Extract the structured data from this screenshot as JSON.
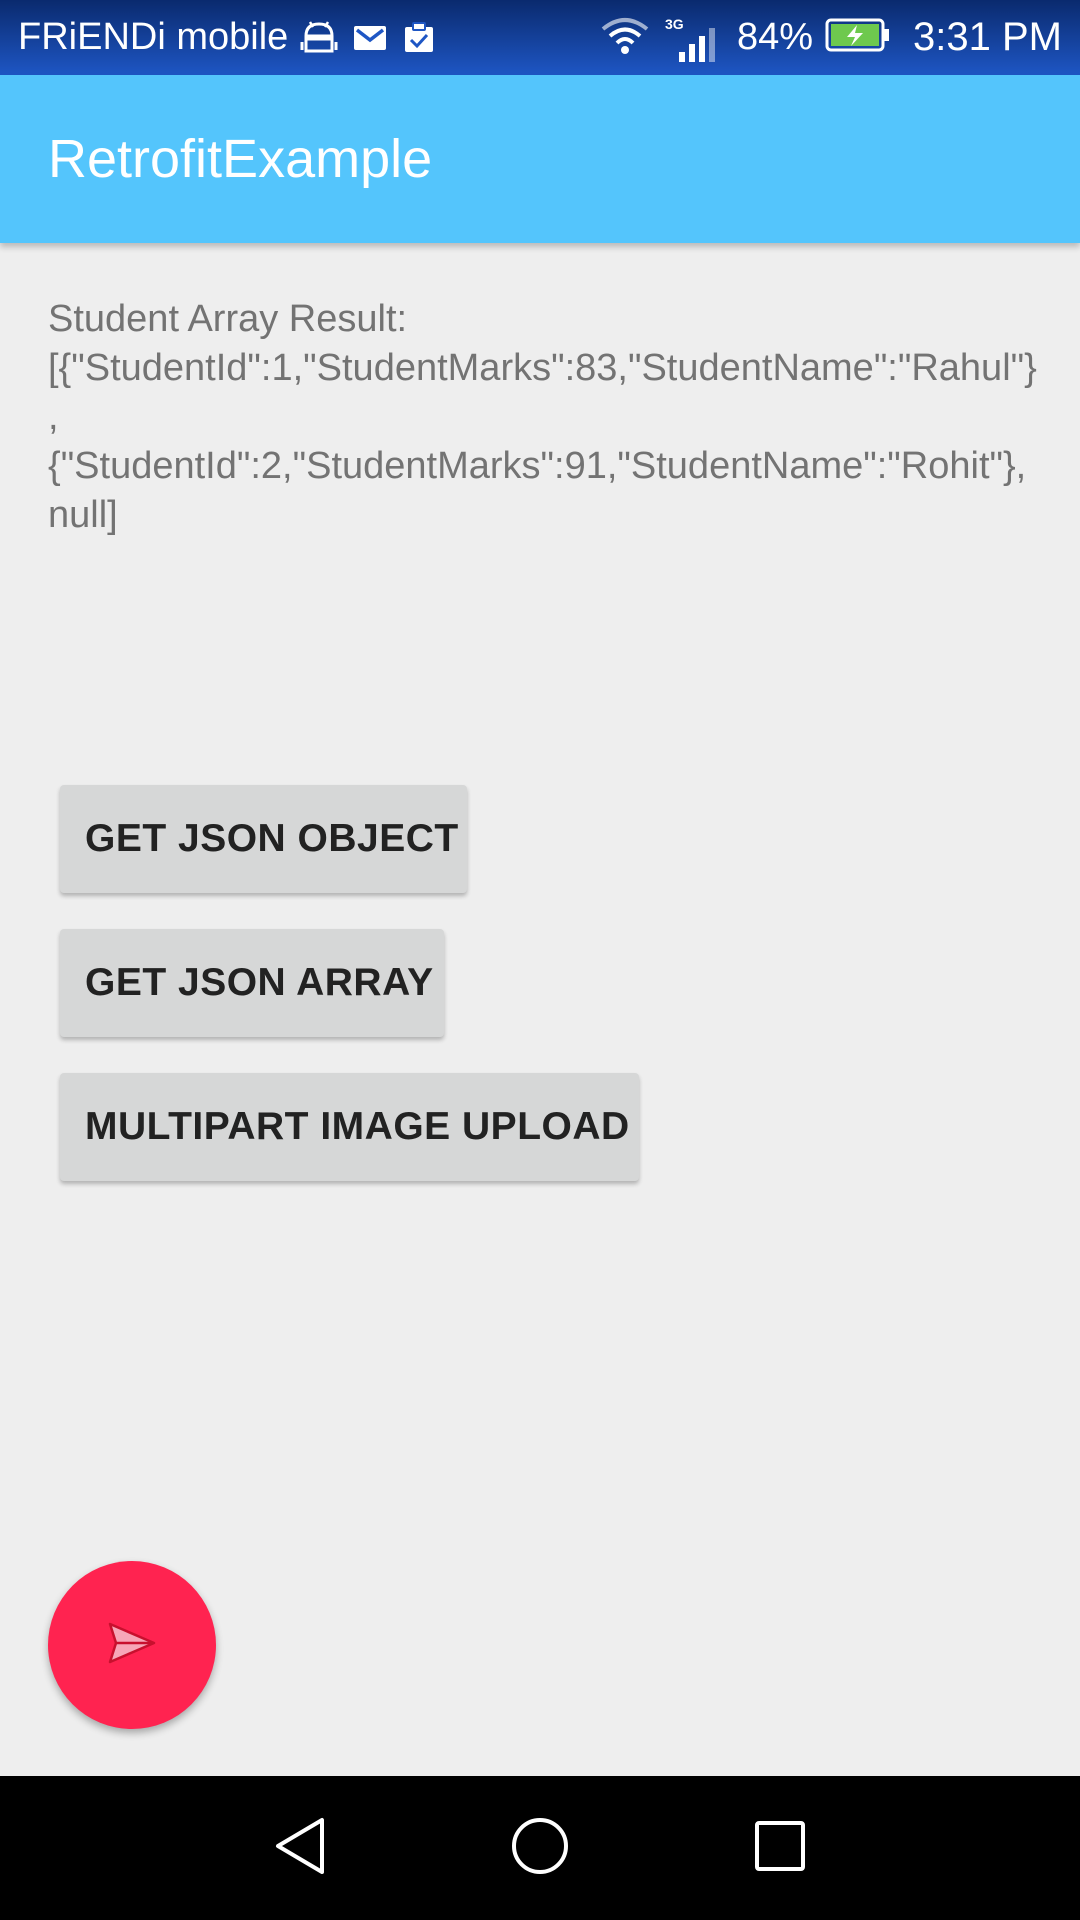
{
  "status_bar": {
    "carrier": "FRiENDi mobile",
    "network_type": "3G",
    "battery_percent": "84%",
    "time": "3:31 PM",
    "icons": [
      "android-notification-icon",
      "gmail-icon",
      "clipboard-check-icon",
      "wifi-icon",
      "signal-icon",
      "battery-charging-icon"
    ]
  },
  "app_bar": {
    "title": "RetrofitExample"
  },
  "content": {
    "result_text": "Student Array Result: [{\"StudentId\":1,\"StudentMarks\":83,\"StudentName\":\"Rahul\"},{\"StudentId\":2,\"StudentMarks\":91,\"StudentName\":\"Rohit\"},null]"
  },
  "buttons": {
    "get_json_object": "GET JSON OBJECT",
    "get_json_array": "GET JSON ARRAY",
    "multipart_upload": "MULTIPART IMAGE UPLOAD"
  },
  "fab": {
    "icon": "send-icon",
    "color": "#ff2350"
  },
  "nav_bar": {
    "icons": [
      "back-icon",
      "home-icon",
      "recents-icon"
    ]
  },
  "colors": {
    "app_bar": "#54c5fc",
    "background": "#eeeeee",
    "button": "#d6d7d7"
  }
}
